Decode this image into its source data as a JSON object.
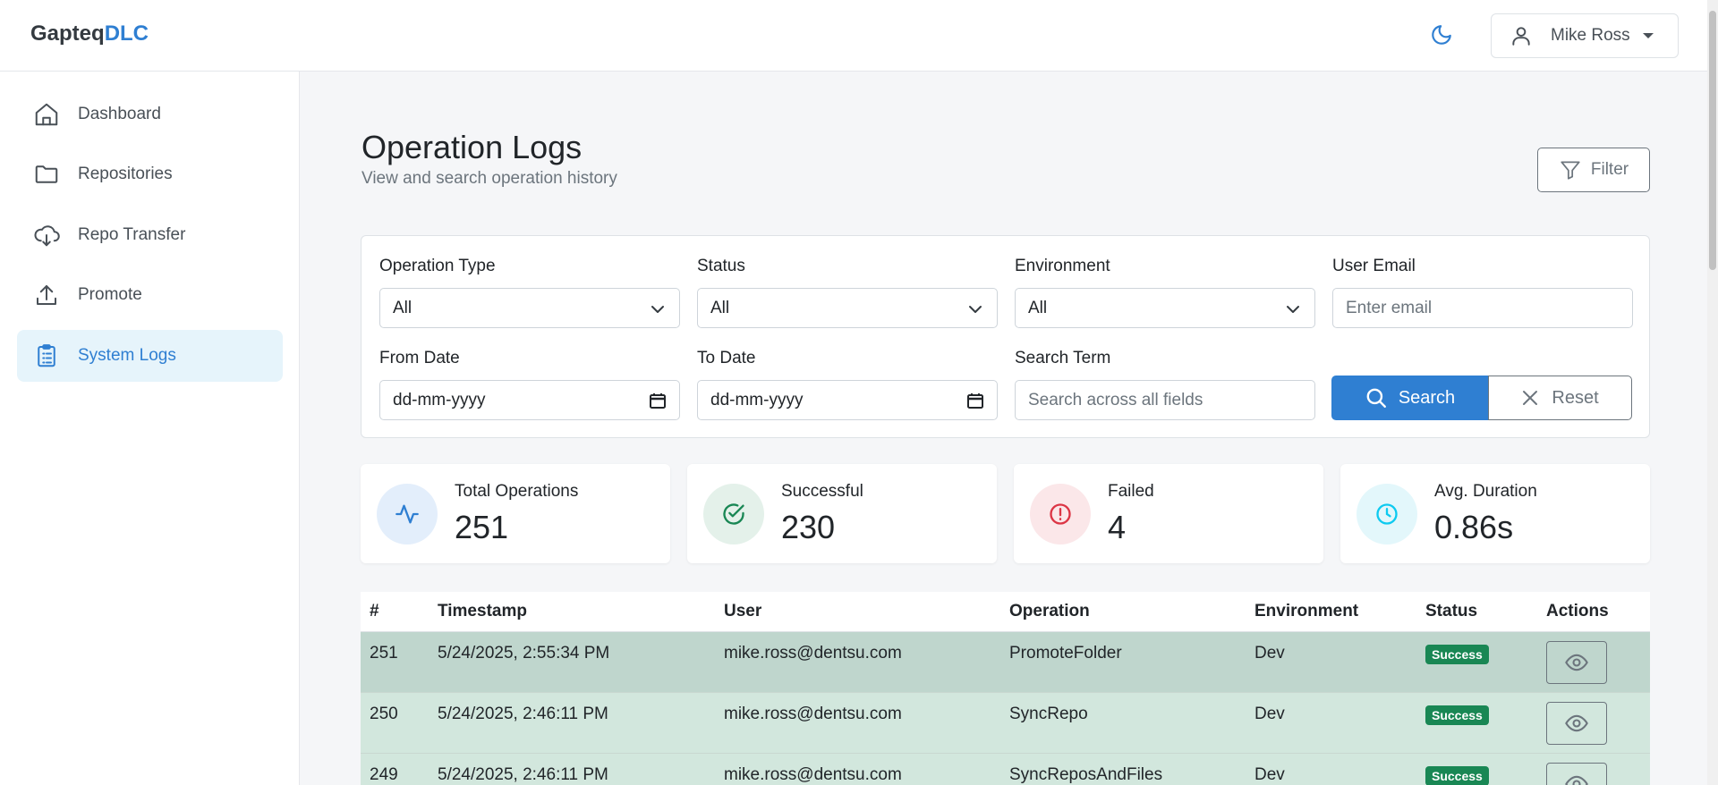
{
  "brand": {
    "part1": "Gapteq",
    "part2": "DLC"
  },
  "header": {
    "theme_icon": "moon-icon",
    "user_name": "Mike Ross"
  },
  "sidebar": {
    "items": [
      {
        "label": "Dashboard",
        "icon": "home-icon"
      },
      {
        "label": "Repositories",
        "icon": "folder-icon"
      },
      {
        "label": "Repo Transfer",
        "icon": "cloud-download-icon"
      },
      {
        "label": "Promote",
        "icon": "upload-icon"
      },
      {
        "label": "System Logs",
        "icon": "clipboard-list-icon",
        "active": true
      }
    ]
  },
  "page": {
    "title": "Operation Logs",
    "subtitle": "View and search operation history",
    "filter_label": "Filter"
  },
  "filters": {
    "operation_type": {
      "label": "Operation Type",
      "value": "All"
    },
    "status": {
      "label": "Status",
      "value": "All"
    },
    "environment": {
      "label": "Environment",
      "value": "All"
    },
    "user_email": {
      "label": "User Email",
      "placeholder": "Enter email"
    },
    "from_date": {
      "label": "From Date",
      "placeholder": "dd-mm-yyyy"
    },
    "to_date": {
      "label": "To Date",
      "placeholder": "dd-mm-yyyy"
    },
    "search_term": {
      "label": "Search Term",
      "placeholder": "Search across all fields"
    },
    "search_label": "Search",
    "reset_label": "Reset"
  },
  "stats": [
    {
      "label": "Total Operations",
      "value": "251",
      "icon": "activity-icon",
      "color": "#2f7fd2"
    },
    {
      "label": "Successful",
      "value": "230",
      "icon": "check-circle-icon",
      "color": "#198754"
    },
    {
      "label": "Failed",
      "value": "4",
      "icon": "alert-circle-icon",
      "color": "#dc3545"
    },
    {
      "label": "Avg. Duration",
      "value": "0.86s",
      "icon": "clock-icon",
      "color": "#0dcaf0"
    }
  ],
  "table": {
    "headers": [
      "#",
      "Timestamp",
      "User",
      "Operation",
      "Environment",
      "Status",
      "Actions"
    ],
    "rows": [
      {
        "id": "251",
        "timestamp": "5/24/2025, 2:55:34 PM",
        "user": "mike.ross@dentsu.com",
        "operation": "PromoteFolder",
        "environment": "Dev",
        "status": "Success"
      },
      {
        "id": "250",
        "timestamp": "5/24/2025, 2:46:11 PM",
        "user": "mike.ross@dentsu.com",
        "operation": "SyncRepo",
        "environment": "Dev",
        "status": "Success"
      },
      {
        "id": "249",
        "timestamp": "5/24/2025, 2:46:11 PM",
        "user": "mike.ross@dentsu.com",
        "operation": "SyncReposAndFiles",
        "environment": "Dev",
        "status": "Success"
      }
    ]
  }
}
